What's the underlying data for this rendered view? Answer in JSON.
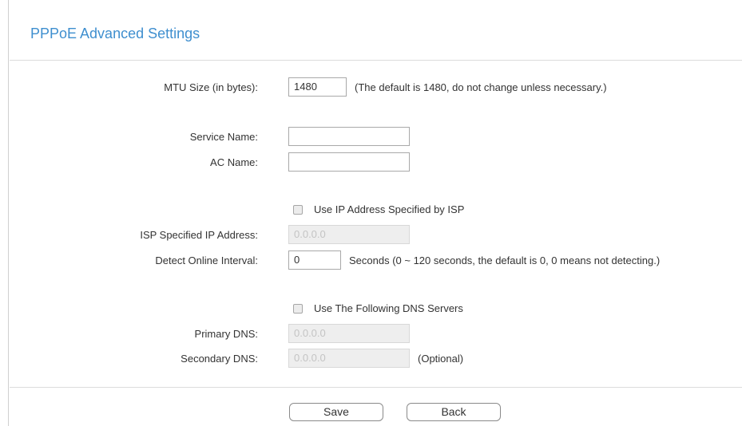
{
  "page": {
    "title": "PPPoE Advanced Settings"
  },
  "mtu": {
    "label": "MTU Size (in bytes):",
    "value": "1480",
    "hint": "(The default is 1480, do not change unless necessary.)"
  },
  "service_name": {
    "label": "Service Name:",
    "value": ""
  },
  "ac_name": {
    "label": "AC Name:",
    "value": ""
  },
  "use_isp_ip": {
    "label": "Use IP Address Specified by ISP",
    "checked": false
  },
  "isp_ip": {
    "label": "ISP Specified IP Address:",
    "value": "0.0.0.0"
  },
  "detect_interval": {
    "label": "Detect Online Interval:",
    "value": "0",
    "hint": "Seconds (0 ~ 120 seconds, the default is 0, 0 means not detecting.)"
  },
  "use_dns": {
    "label": "Use The Following DNS Servers",
    "checked": false
  },
  "primary_dns": {
    "label": "Primary DNS:",
    "value": "0.0.0.0"
  },
  "secondary_dns": {
    "label": "Secondary DNS:",
    "value": "0.0.0.0",
    "hint": "(Optional)"
  },
  "buttons": {
    "save": "Save",
    "back": "Back"
  },
  "colors": {
    "title": "#3f8fcf",
    "disabled_field": "#eeeeee"
  }
}
